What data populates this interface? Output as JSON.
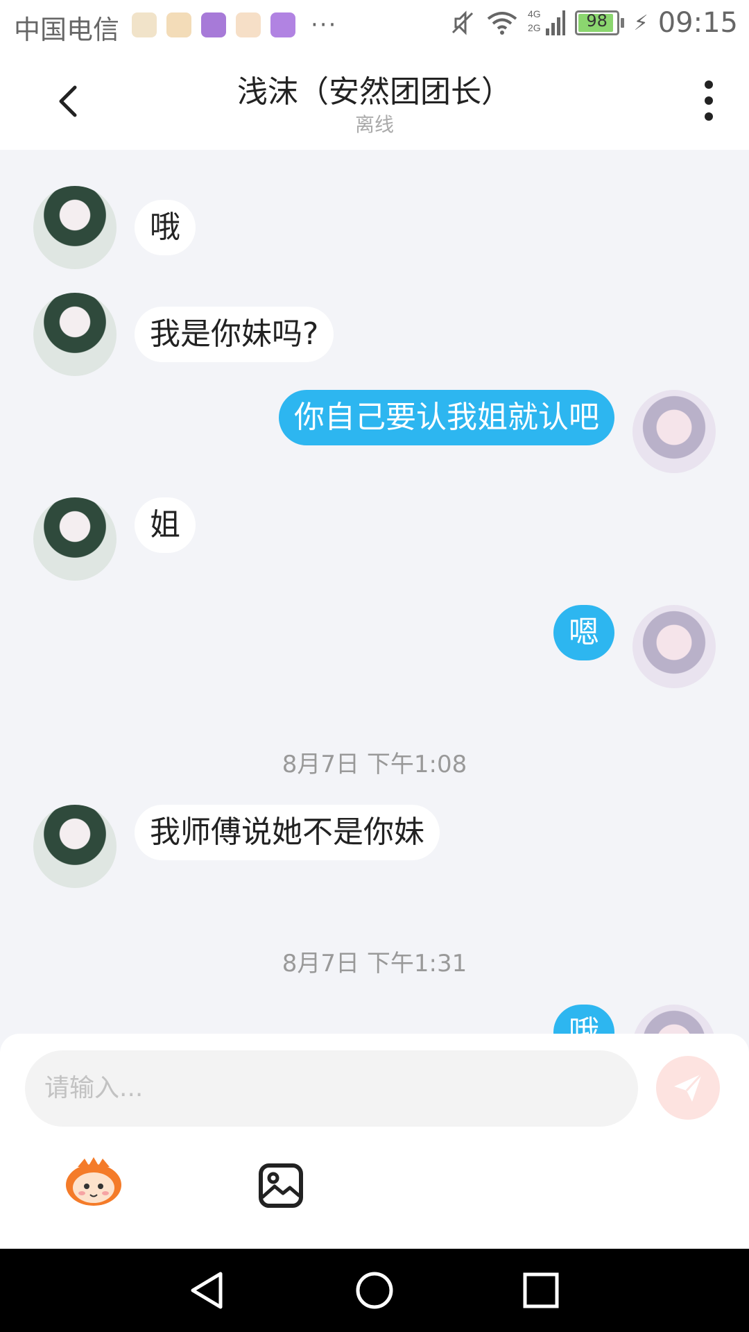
{
  "status_bar": {
    "carrier": "中国电信",
    "more": "···",
    "battery": "98",
    "time": "09:15"
  },
  "header": {
    "title": "浅沫（安然团团长）",
    "subtitle": "离线"
  },
  "messages": [
    {
      "side": "left",
      "text": "哦"
    },
    {
      "side": "left",
      "text": "我是你妹吗?"
    },
    {
      "side": "right",
      "text": "你自己要认我姐就认吧"
    },
    {
      "side": "left",
      "text": "姐"
    },
    {
      "side": "right",
      "text": "嗯"
    }
  ],
  "timestamps": [
    "8月7日 下午1:08",
    "8月7日 下午1:31"
  ],
  "later_messages": [
    {
      "side": "left",
      "text": "我师傅说她不是你妹"
    },
    {
      "side": "right",
      "text": "哦"
    }
  ],
  "composer": {
    "placeholder": "请输入..."
  },
  "colors": {
    "accent_blue": "#2db6f0",
    "send_disabled": "#fde3e0",
    "chat_bg": "#f3f4f8"
  },
  "icons": [
    "back-icon",
    "more-vertical-icon",
    "send-icon",
    "sticker-icon",
    "image-icon",
    "nav-back-icon",
    "nav-home-icon",
    "nav-recents-icon",
    "mute-icon",
    "wifi-icon",
    "signal-icon",
    "battery-icon"
  ]
}
